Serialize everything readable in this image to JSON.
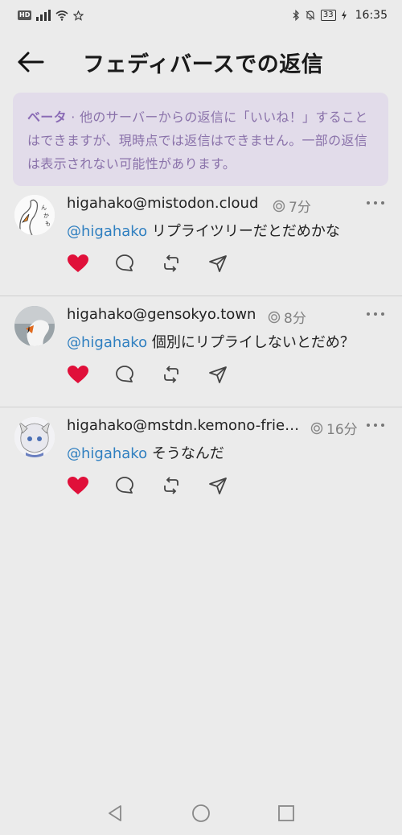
{
  "status_bar": {
    "badge": "HD",
    "battery": "33",
    "time": "16:35",
    "icons": [
      "signal-icon",
      "wifi-icon",
      "star-icon",
      "bluetooth-icon",
      "bell-off-icon",
      "battery-icon"
    ]
  },
  "header": {
    "title": "フェディバースでの返信",
    "back_icon": "arrow-left-icon"
  },
  "notice": {
    "label": "ベータ",
    "separator": " · ",
    "text": "他のサーバーからの返信に「いいね！」することはできますが、現時点では返信はできません。一部の返信は表示されない可能性があります。"
  },
  "posts": [
    {
      "account": "higahako@mistodon.cloud",
      "time": "7分",
      "mention": "@higahako",
      "text": "リプライツリーだとだめかな",
      "liked": true
    },
    {
      "account": "higahako@gensokyo.town",
      "time": "8分",
      "mention": "@higahako",
      "text": "個別にリプライしないとだめ？",
      "liked": true
    },
    {
      "account": "higahako@mstdn.kemono-friends.info",
      "time": "16分",
      "mention": "@higahako",
      "text": "そうなんだ",
      "liked": true
    }
  ],
  "colors": {
    "like": "#e0103a",
    "mention": "#2f7fc0",
    "notice_bg": "#e2dcea",
    "notice_text": "#8a72aa",
    "background": "#ebebeb"
  },
  "navbar": {
    "icons": [
      "back-triangle-icon",
      "home-circle-icon",
      "recents-square-icon"
    ]
  }
}
